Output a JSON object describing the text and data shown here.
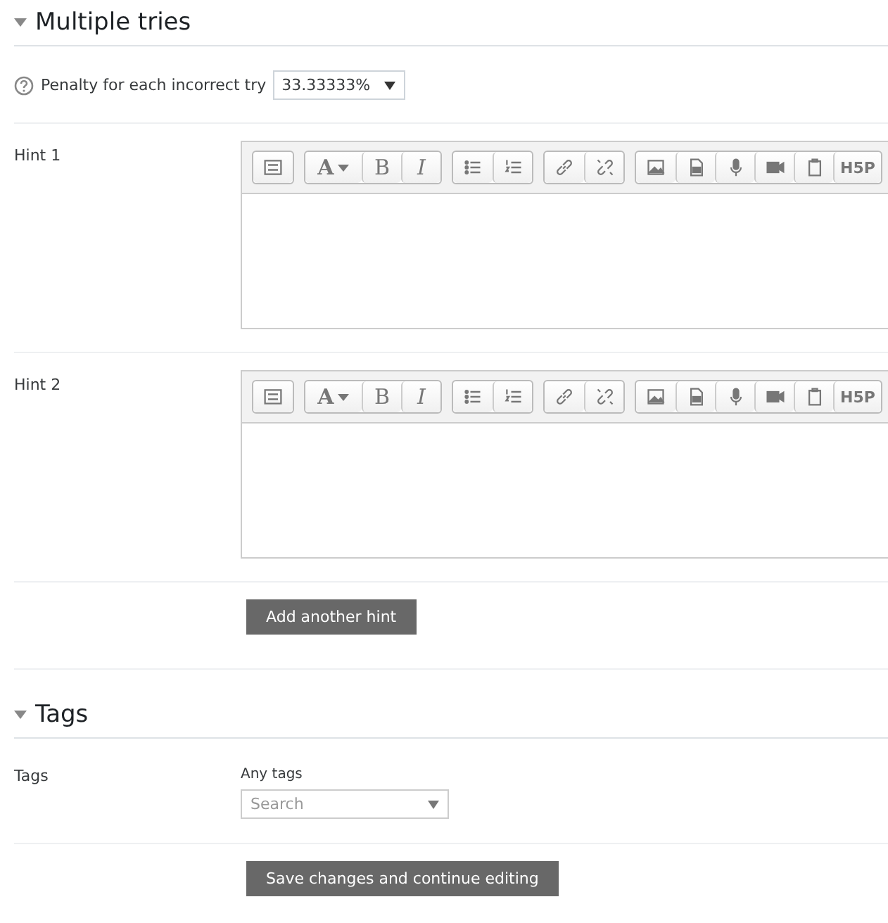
{
  "sections": [
    {
      "kind": "tries",
      "title": "Multiple tries",
      "expanded": true,
      "penalty": {
        "label": "Penalty for each incorrect try",
        "value": "33.33333%"
      },
      "hints": [
        {
          "label": "Hint 1",
          "toolbar": [
            {
              "kind": "collapse"
            },
            {
              "kind": "fontcolor",
              "label": "A"
            },
            {
              "kind": "bold",
              "label": "B"
            },
            {
              "kind": "italic",
              "label": "I"
            },
            {
              "kind": "bullets"
            },
            {
              "kind": "numbers"
            },
            {
              "kind": "link"
            },
            {
              "kind": "unlink"
            },
            {
              "kind": "image"
            },
            {
              "kind": "media"
            },
            {
              "kind": "audio"
            },
            {
              "kind": "video"
            },
            {
              "kind": "files"
            },
            {
              "kind": "h5p",
              "label": "H5P"
            }
          ]
        },
        {
          "label": "Hint 2",
          "toolbar": [
            {
              "kind": "collapse"
            },
            {
              "kind": "fontcolor",
              "label": "A"
            },
            {
              "kind": "bold",
              "label": "B"
            },
            {
              "kind": "italic",
              "label": "I"
            },
            {
              "kind": "bullets"
            },
            {
              "kind": "numbers"
            },
            {
              "kind": "link"
            },
            {
              "kind": "unlink"
            },
            {
              "kind": "image"
            },
            {
              "kind": "media"
            },
            {
              "kind": "audio"
            },
            {
              "kind": "video"
            },
            {
              "kind": "files"
            },
            {
              "kind": "h5p",
              "label": "H5P"
            }
          ]
        }
      ],
      "add_button": "Add another hint"
    },
    {
      "kind": "tags",
      "title": "Tags",
      "expanded": true,
      "label": "Tags",
      "field_label": "Any tags",
      "placeholder": "Search"
    }
  ],
  "save_button": "Save changes and continue editing"
}
